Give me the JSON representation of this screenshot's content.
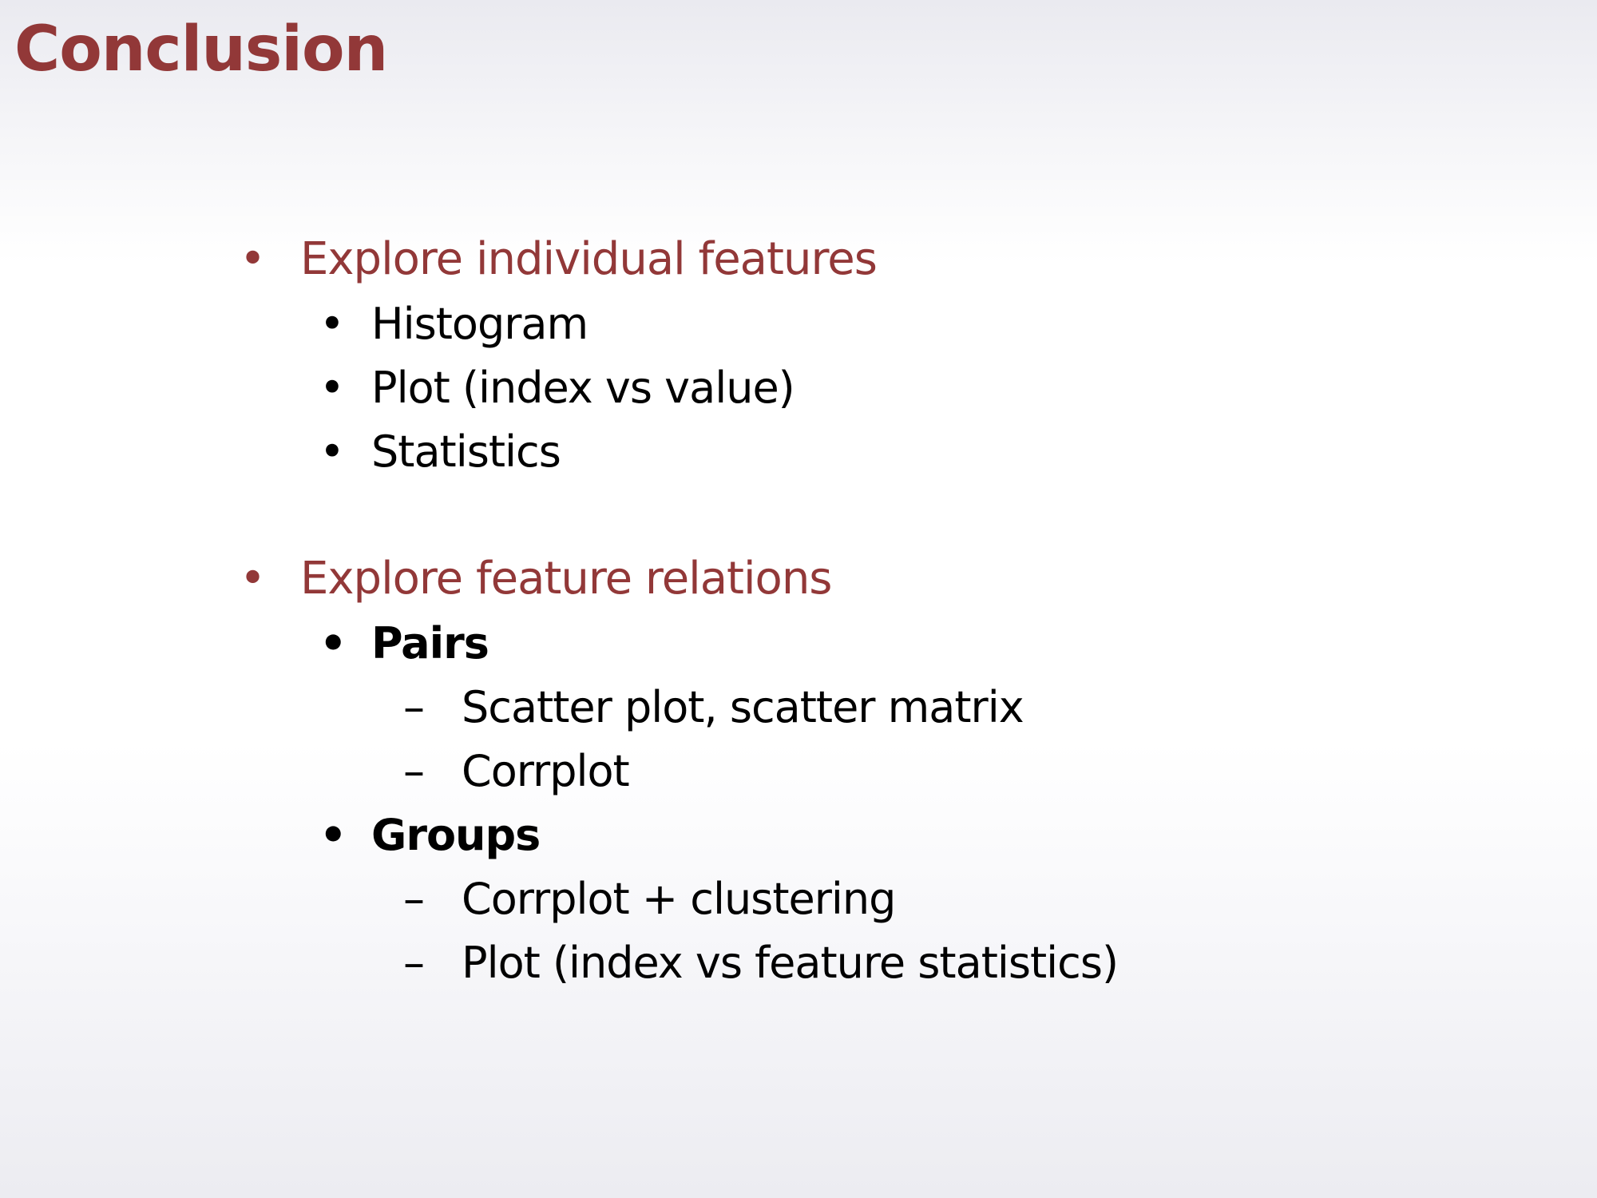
{
  "theme": {
    "accent_color": "#923838",
    "text_color": "#000000"
  },
  "slide": {
    "title": "Conclusion",
    "sections": [
      {
        "bullet": "•",
        "heading": "Explore individual features",
        "items": [
          {
            "bullet": "•",
            "label": "Histogram"
          },
          {
            "bullet": "•",
            "label": "Plot (index vs value)"
          },
          {
            "bullet": "•",
            "label": "Statistics"
          }
        ]
      },
      {
        "bullet": "•",
        "heading": "Explore feature relations",
        "items": [
          {
            "bullet": "•",
            "label": "Pairs",
            "subitems": [
              {
                "dash": "–",
                "label": "Scatter plot, scatter matrix"
              },
              {
                "dash": "–",
                "label": "Corrplot"
              }
            ]
          },
          {
            "bullet": "•",
            "label": "Groups",
            "subitems": [
              {
                "dash": "–",
                "label": "Corrplot + clustering"
              },
              {
                "dash": "–",
                "label": "Plot (index vs feature statistics)"
              }
            ]
          }
        ]
      }
    ]
  }
}
